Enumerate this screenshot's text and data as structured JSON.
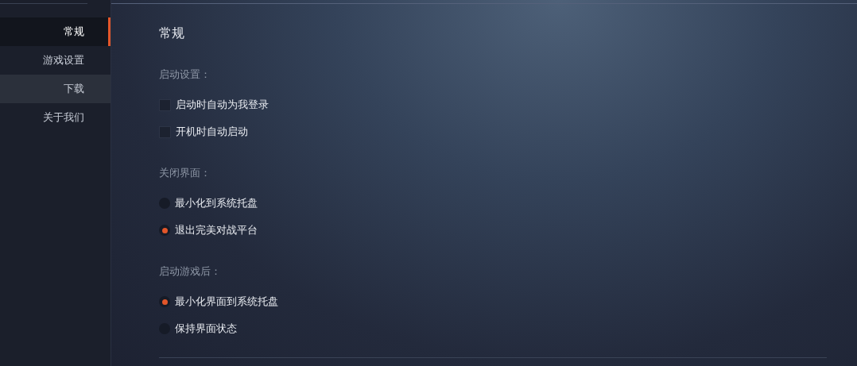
{
  "sidebar": {
    "items": [
      {
        "label": "常规",
        "selected": true,
        "highlighted": false
      },
      {
        "label": "游戏设置",
        "selected": false,
        "highlighted": false
      },
      {
        "label": "下载",
        "selected": false,
        "highlighted": true
      },
      {
        "label": "关于我们",
        "selected": false,
        "highlighted": false
      }
    ]
  },
  "page_title": "常规",
  "sections": [
    {
      "heading": "启动设置：",
      "options": [
        {
          "kind": "checkbox",
          "label": "启动时自动为我登录",
          "checked": false
        },
        {
          "kind": "checkbox",
          "label": "开机时自动启动",
          "checked": false
        }
      ]
    },
    {
      "heading": "关闭界面：",
      "options": [
        {
          "kind": "radio",
          "label": "最小化到系统托盘",
          "selected": false
        },
        {
          "kind": "radio",
          "label": "退出完美对战平台",
          "selected": true
        }
      ]
    },
    {
      "heading": "启动游戏后：",
      "options": [
        {
          "kind": "radio",
          "label": "最小化界面到系统托盘",
          "selected": true
        },
        {
          "kind": "radio",
          "label": "保持界面状态",
          "selected": false
        }
      ]
    }
  ]
}
